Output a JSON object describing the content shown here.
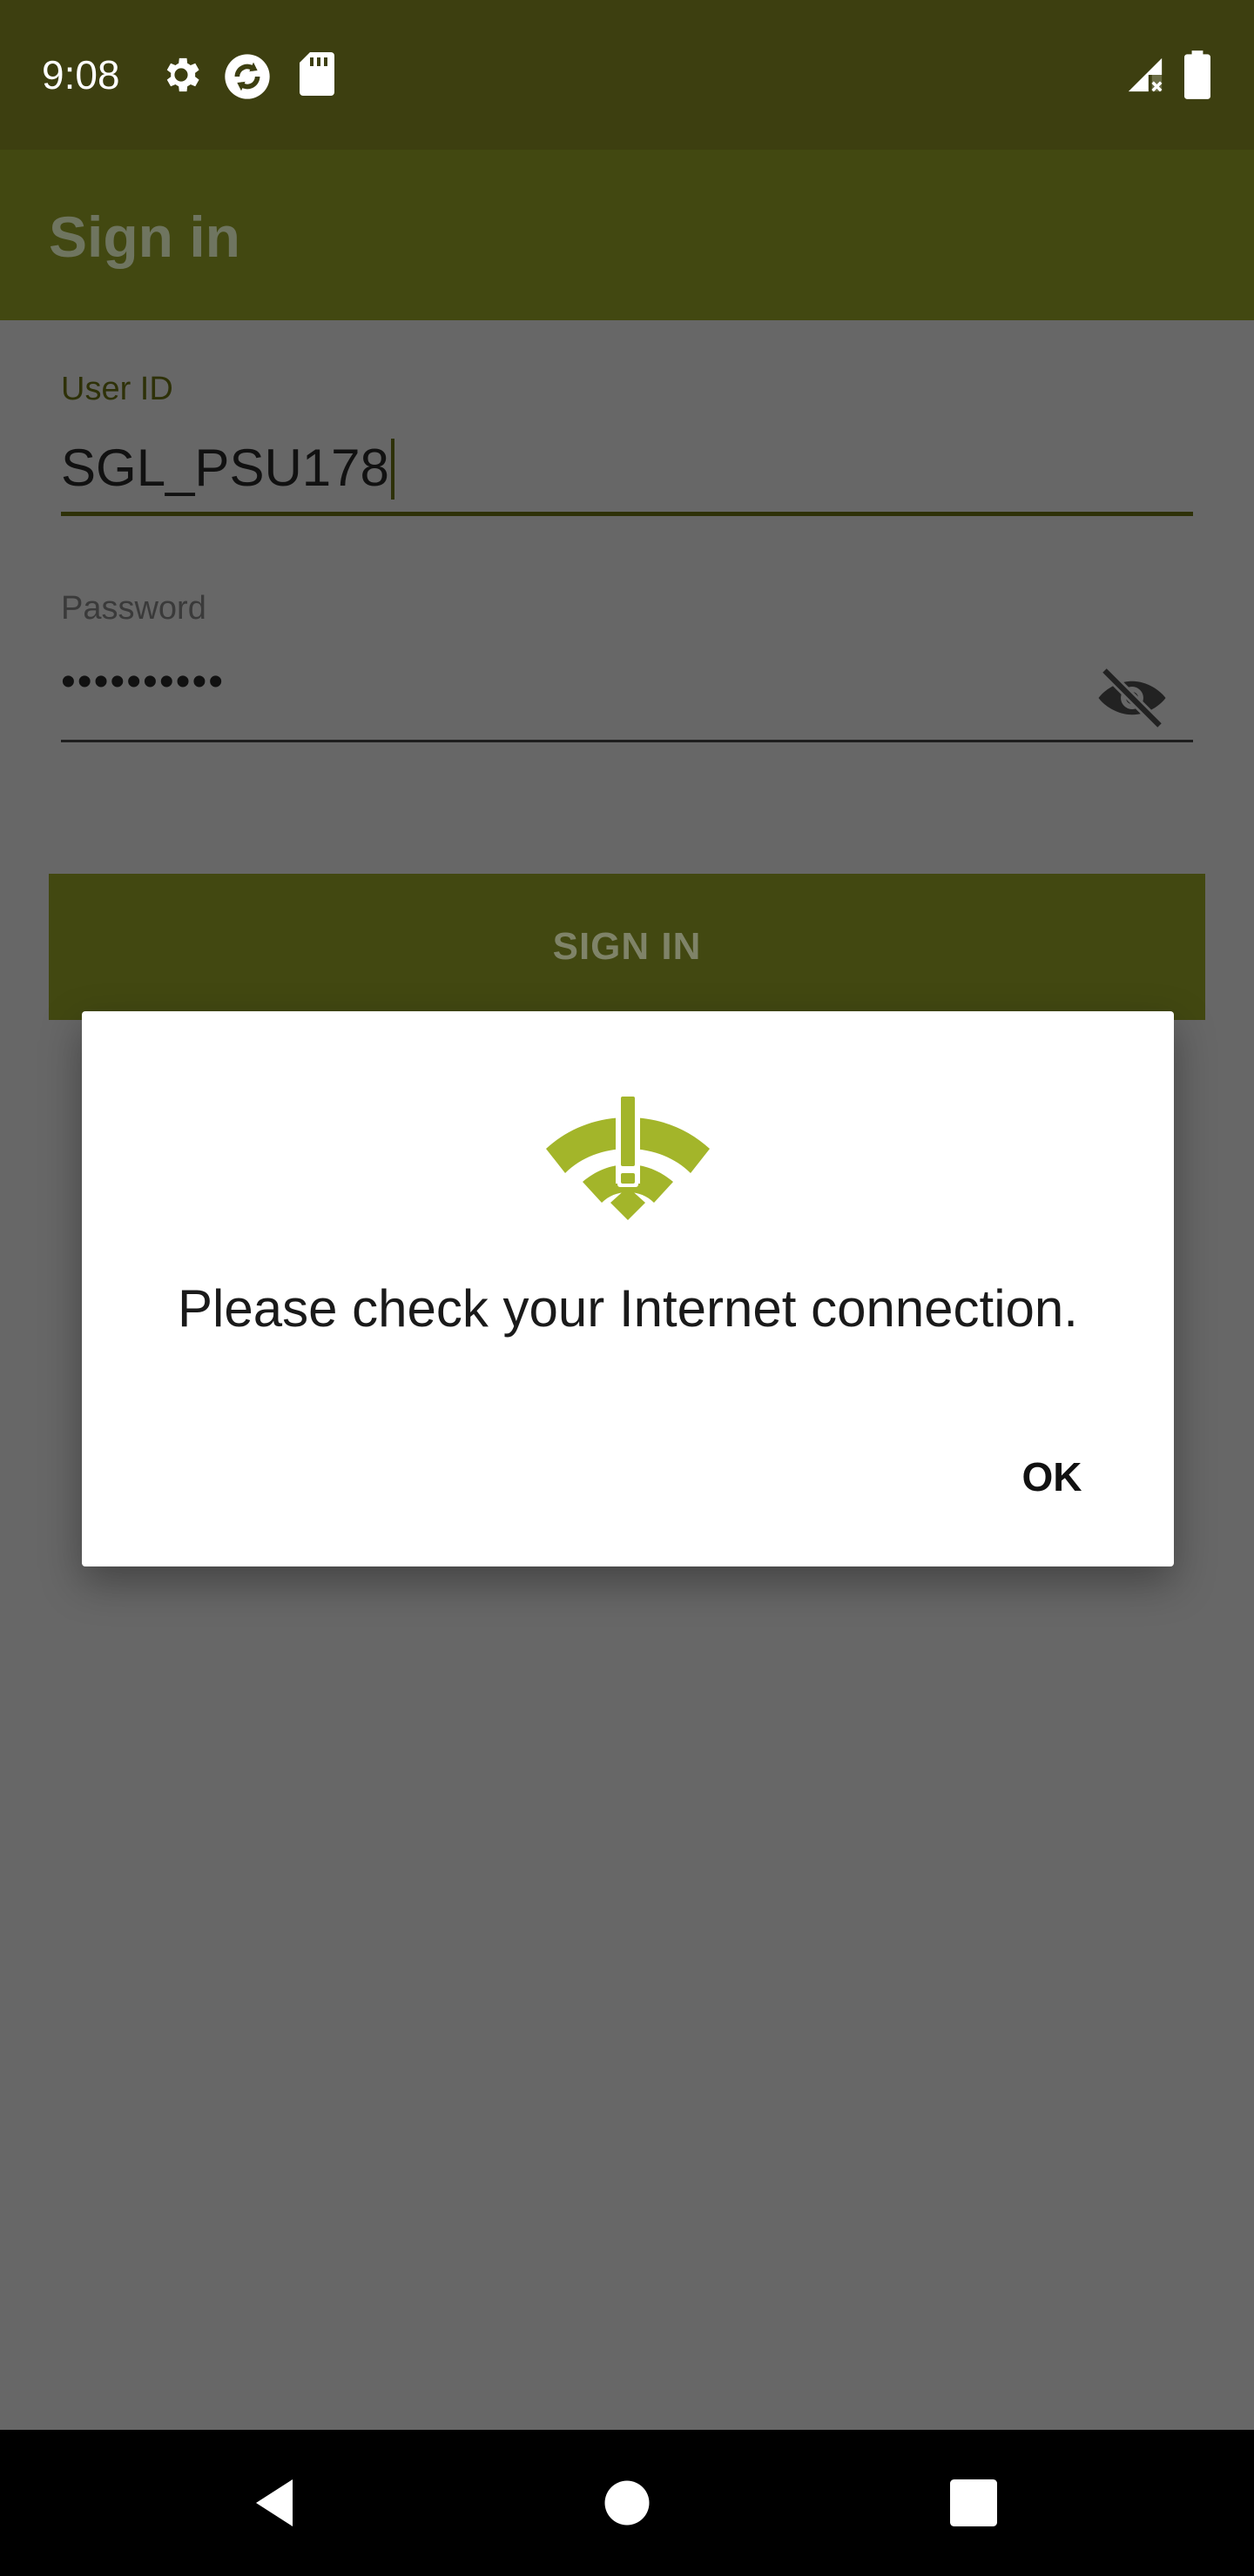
{
  "status_bar": {
    "time": "9:08",
    "icons": [
      "gear-icon",
      "sync-icon",
      "sd-card-icon",
      "signal-no-service-icon",
      "battery-icon"
    ]
  },
  "app_bar": {
    "title": "Sign in"
  },
  "form": {
    "user_id": {
      "label": "User ID",
      "value": "SGL_PSU178"
    },
    "password": {
      "label": "Password",
      "value": "••••••••••"
    },
    "sign_in_label": "SIGN IN"
  },
  "dialog": {
    "icon": "wifi-alert-icon",
    "message": "Please check your Internet connection.",
    "ok_label": "OK"
  },
  "nav_bar": {
    "icons": [
      "back-icon",
      "home-icon",
      "recents-icon"
    ]
  },
  "colors": {
    "status_bar": "#3d3f10",
    "app_bar": "#424811",
    "scrim_background": "#676767",
    "dialog_icon": "#a3b52a",
    "dialog_background": "#ffffff"
  }
}
